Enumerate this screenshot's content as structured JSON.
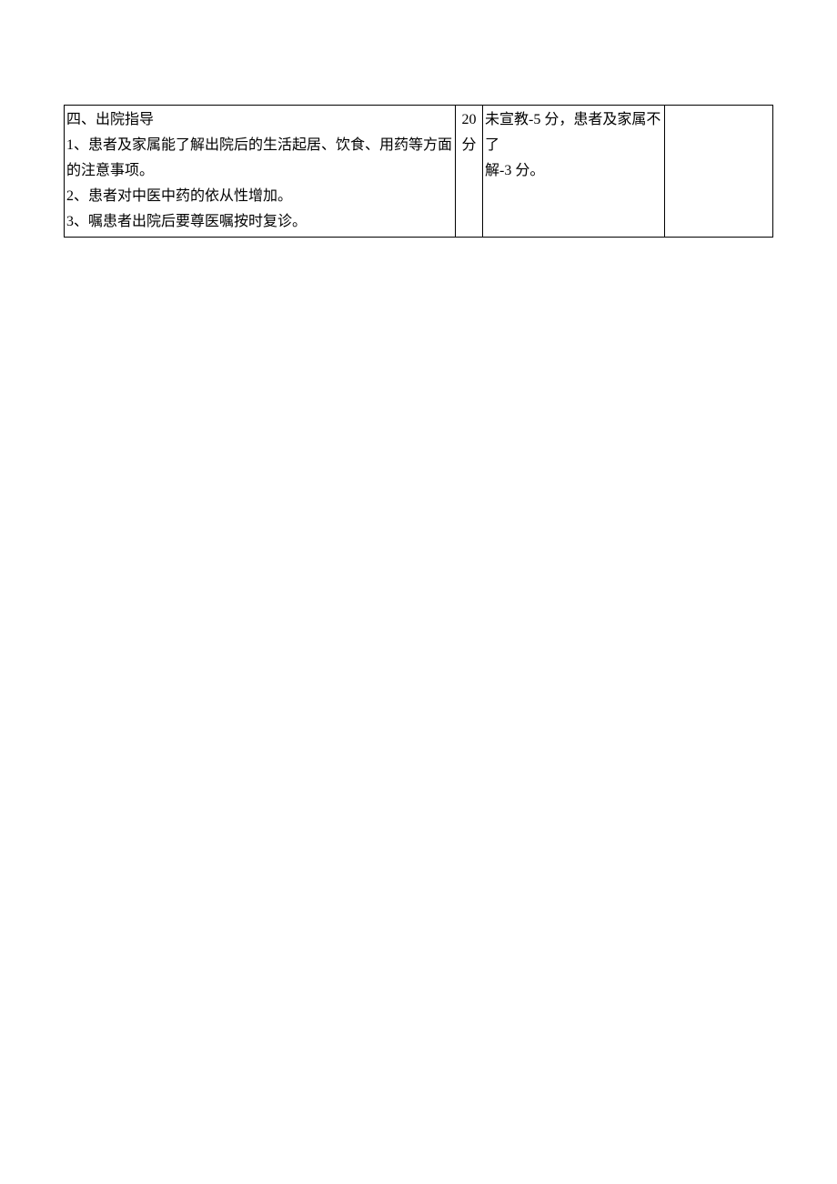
{
  "table": {
    "row": {
      "col1": {
        "heading": "四、出院指导",
        "item1": "1、患者及家属能了解出院后的生活起居、饮食、用药等方面的注意事项。",
        "item2": "2、患者对中医中药的依从性增加。",
        "item3": "3、嘱患者出院后要尊医嘱按时复诊。"
      },
      "col2": {
        "score_num": "20",
        "score_unit": "分"
      },
      "col3": {
        "line1": "未宣教-5 分，患者及家属不了",
        "line2": "解-3 分。"
      },
      "col4": ""
    }
  }
}
